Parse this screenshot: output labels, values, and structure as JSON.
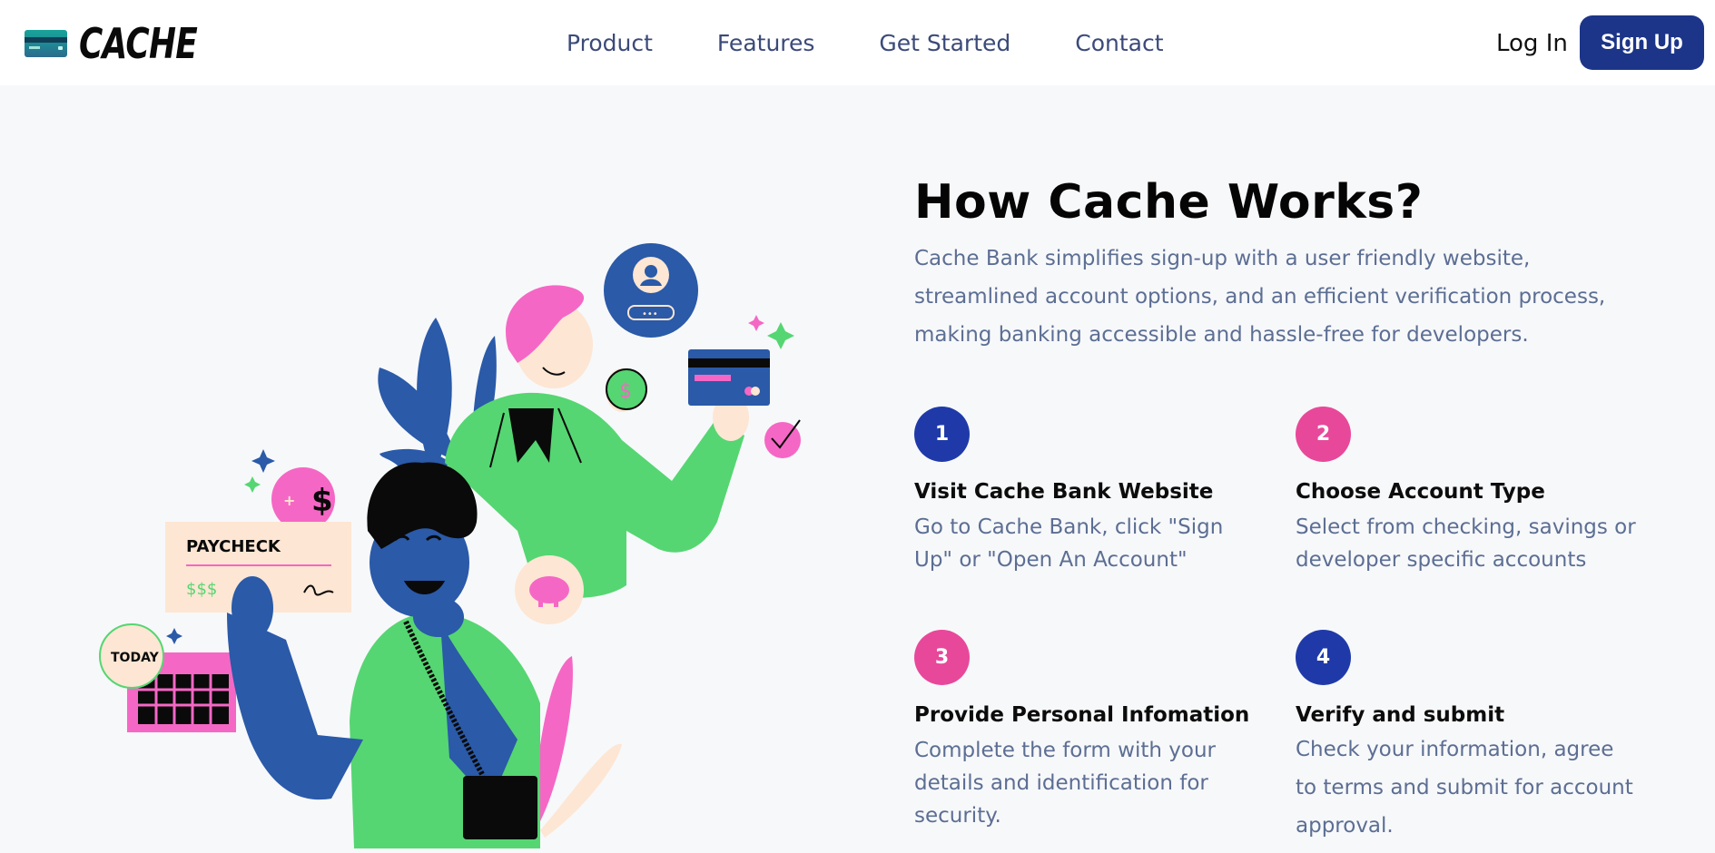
{
  "brand": {
    "name": "CACHE"
  },
  "nav": {
    "items": [
      {
        "label": "Product"
      },
      {
        "label": "Features"
      },
      {
        "label": "Get Started"
      },
      {
        "label": "Contact"
      }
    ],
    "login_label": "Log In",
    "signup_label": "Sign Up"
  },
  "illustration": {
    "paycheck_label": "PAYCHECK",
    "paycheck_amount": "$$$",
    "today_label": "TODAY"
  },
  "section": {
    "title": "How Cache Works?",
    "intro": "Cache Bank simplifies sign-up with a user friendly website, streamlined account options, and an efficient verification process, making banking accessible and hassle-free for developers.",
    "steps": [
      {
        "number": "1",
        "title": "Visit Cache Bank Website",
        "text": "Go to Cache Bank, click \"Sign Up\" or \"Open An Account\"",
        "color": "#1f3aa8"
      },
      {
        "number": "2",
        "title": "Choose Account Type",
        "text": "Select from checking, savings or developer specific accounts",
        "color": "#e8489a"
      },
      {
        "number": "3",
        "title": "Provide Personal Infomation",
        "text": "Complete the form with your details and identification for security.",
        "color": "#e8489a"
      },
      {
        "number": "4",
        "title": "Verify and submit",
        "text": "Check your information, agree to terms and submit for account approval.",
        "color": "#1f3aa8"
      }
    ]
  },
  "colors": {
    "primary": "#1c3588",
    "pink": "#e8489a",
    "green": "#55d672",
    "blue": "#2a5aa8",
    "muted_text": "#5c6e93"
  }
}
